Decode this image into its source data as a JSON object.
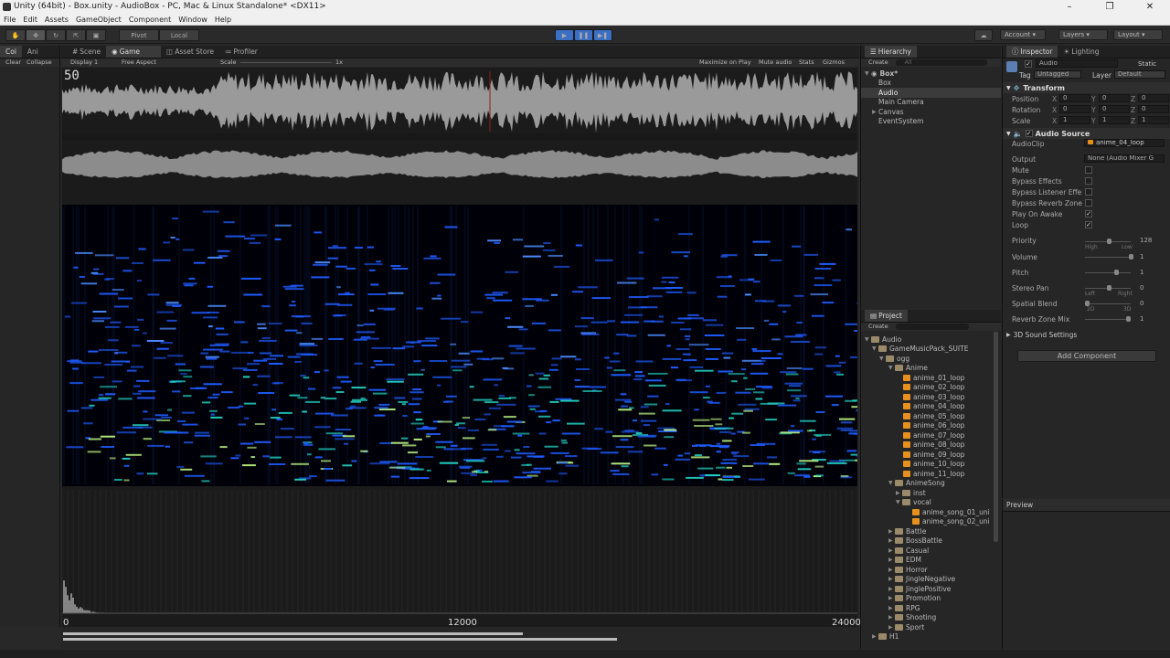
{
  "window": {
    "title": "Unity (64bit) - Box.unity - AudioBox - PC, Mac & Linux Standalone* <DX11>"
  },
  "menu": [
    "File",
    "Edit",
    "Assets",
    "GameObject",
    "Component",
    "Window",
    "Help"
  ],
  "toolbar": {
    "pivot": "Pivot",
    "local": "Local",
    "account": "Account",
    "layers": "Layers",
    "layout": "Layout"
  },
  "left_tabs": {
    "console": "Coi",
    "animation": "Ani",
    "clear": "Clear",
    "collapse": "Collapse"
  },
  "game_tabs": {
    "scene": "Scene",
    "game": "Game",
    "asset_store": "Asset Store",
    "profiler": "Profiler"
  },
  "game_bar": {
    "display": "Display 1",
    "aspect": "Free Aspect",
    "scale_label": "Scale",
    "scale_value": "1x",
    "maximize": "Maximize on Play",
    "mute": "Mute audio",
    "stats": "Stats",
    "gizmos": "Gizmos"
  },
  "viewport": {
    "fps": "50",
    "axis_start": "0",
    "axis_mid": "12000",
    "axis_end": "24000"
  },
  "hierarchy": {
    "title": "Hierarchy",
    "create": "Create",
    "search": "All",
    "scene": "Box*",
    "items": [
      "Box",
      "Audio",
      "Main Camera",
      "Canvas",
      "EventSystem"
    ]
  },
  "project": {
    "title": "Project",
    "create": "Create",
    "tree": {
      "audio": "Audio",
      "suite": "GameMusicPack_SUITE",
      "ogg": "ogg",
      "anime": "Anime",
      "loops": [
        "anime_01_loop",
        "anime_02_loop",
        "anime_03_loop",
        "anime_04_loop",
        "anime_05_loop",
        "anime_06_loop",
        "anime_07_loop",
        "anime_08_loop",
        "anime_09_loop",
        "anime_10_loop",
        "anime_11_loop"
      ],
      "animesong": "AnimeSong",
      "inst": "inst",
      "vocal": "vocal",
      "songs": [
        "anime_song_01_uni",
        "anime_song_02_uni"
      ],
      "folders": [
        "Battle",
        "BossBattle",
        "Casual",
        "EDM",
        "Horror",
        "JingleNegative",
        "JinglePositive",
        "Promotion",
        "RPG",
        "Shooting",
        "Sport"
      ],
      "h1": "H1"
    }
  },
  "inspector": {
    "tab_inspector": "Inspector",
    "tab_lighting": "Lighting",
    "object_name": "Audio",
    "static": "Static",
    "tag_label": "Tag",
    "tag_value": "Untagged",
    "layer_label": "Layer",
    "layer_value": "Default",
    "transform": {
      "title": "Transform",
      "position": "Position",
      "rotation": "Rotation",
      "scale": "Scale",
      "px": "0",
      "py": "0",
      "pz": "0",
      "rx": "0",
      "ry": "0",
      "rz": "0",
      "sx": "1",
      "sy": "1",
      "sz": "1"
    },
    "audio_source": {
      "title": "Audio Source",
      "audioclip_label": "AudioClip",
      "audioclip_value": "anime_04_loop",
      "output_label": "Output",
      "output_value": "None (Audio Mixer G",
      "mute": "Mute",
      "bypass_effects": "Bypass Effects",
      "bypass_listener": "Bypass Listener Effe",
      "bypass_reverb": "Bypass Reverb Zone",
      "play_on_awake": "Play On Awake",
      "loop": "Loop",
      "priority": "Priority",
      "priority_value": "128",
      "high": "High",
      "low": "Low",
      "volume": "Volume",
      "volume_value": "1",
      "pitch": "Pitch",
      "pitch_value": "1",
      "stereo_pan": "Stereo Pan",
      "stereo_pan_value": "0",
      "left": "Left",
      "right": "Right",
      "spatial_blend": "Spatial Blend",
      "spatial_blend_value": "0",
      "twod": "2D",
      "threed": "3D",
      "reverb_mix": "Reverb Zone Mix",
      "reverb_mix_value": "1",
      "sound3d": "3D Sound Settings"
    },
    "add_component": "Add Component"
  },
  "preview": {
    "title": "Preview"
  },
  "colors": {
    "accent_play": "#3a6fc4",
    "audio_icon": "#e8901e",
    "folder": "#9a8a6a",
    "waveform": "#9a9a9a"
  }
}
